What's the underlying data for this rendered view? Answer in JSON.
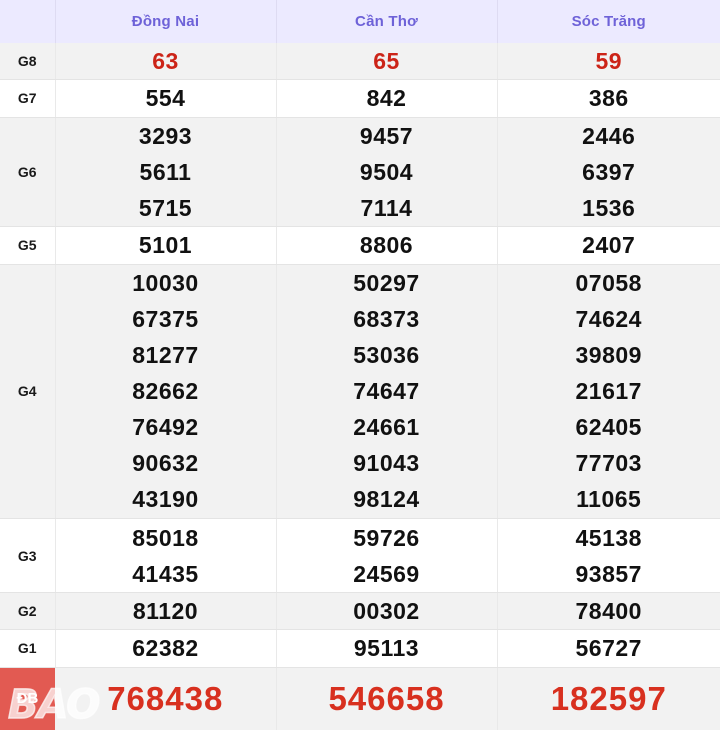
{
  "table": {
    "corner_label": "",
    "columns": [
      "Đồng Nai",
      "Cần Thơ",
      "Sóc Trăng"
    ],
    "colors": {
      "header_bg": "#eceaff",
      "header_text": "#6e62d8",
      "stripe_bg": "#f2f2f2",
      "plain_bg": "#ffffff",
      "g8_red": "#cc2418",
      "db_red": "#d8301f",
      "db_label_bg": "#e25a52",
      "border": "#e4e4e4"
    },
    "rows": [
      {
        "prize": "G8",
        "shade": true,
        "highlight": "hot",
        "values": [
          [
            "63"
          ],
          [
            "65"
          ],
          [
            "59"
          ]
        ]
      },
      {
        "prize": "G7",
        "shade": false,
        "highlight": "normal",
        "values": [
          [
            "554"
          ],
          [
            "842"
          ],
          [
            "386"
          ]
        ]
      },
      {
        "prize": "G6",
        "shade": true,
        "highlight": "normal",
        "values": [
          [
            "3293",
            "5611",
            "5715"
          ],
          [
            "9457",
            "9504",
            "7114"
          ],
          [
            "2446",
            "6397",
            "1536"
          ]
        ]
      },
      {
        "prize": "G5",
        "shade": false,
        "highlight": "normal",
        "values": [
          [
            "5101"
          ],
          [
            "8806"
          ],
          [
            "2407"
          ]
        ]
      },
      {
        "prize": "G4",
        "shade": true,
        "highlight": "normal",
        "values": [
          [
            "10030",
            "67375",
            "81277",
            "82662",
            "76492",
            "90632",
            "43190"
          ],
          [
            "50297",
            "68373",
            "53036",
            "74647",
            "24661",
            "91043",
            "98124"
          ],
          [
            "07058",
            "74624",
            "39809",
            "21617",
            "62405",
            "77703",
            "11065"
          ]
        ]
      },
      {
        "prize": "G3",
        "shade": false,
        "highlight": "normal",
        "values": [
          [
            "85018",
            "41435"
          ],
          [
            "59726",
            "24569"
          ],
          [
            "45138",
            "93857"
          ]
        ]
      },
      {
        "prize": "G2",
        "shade": true,
        "highlight": "normal",
        "values": [
          [
            "81120"
          ],
          [
            "00302"
          ],
          [
            "78400"
          ]
        ]
      },
      {
        "prize": "G1",
        "shade": false,
        "highlight": "normal",
        "values": [
          [
            "62382"
          ],
          [
            "95113"
          ],
          [
            "56727"
          ]
        ]
      },
      {
        "prize": "ĐB",
        "shade": true,
        "highlight": "jackpot",
        "values": [
          [
            "768438"
          ],
          [
            "546658"
          ],
          [
            "182597"
          ]
        ]
      }
    ]
  },
  "watermark": {
    "text": "BAO"
  }
}
